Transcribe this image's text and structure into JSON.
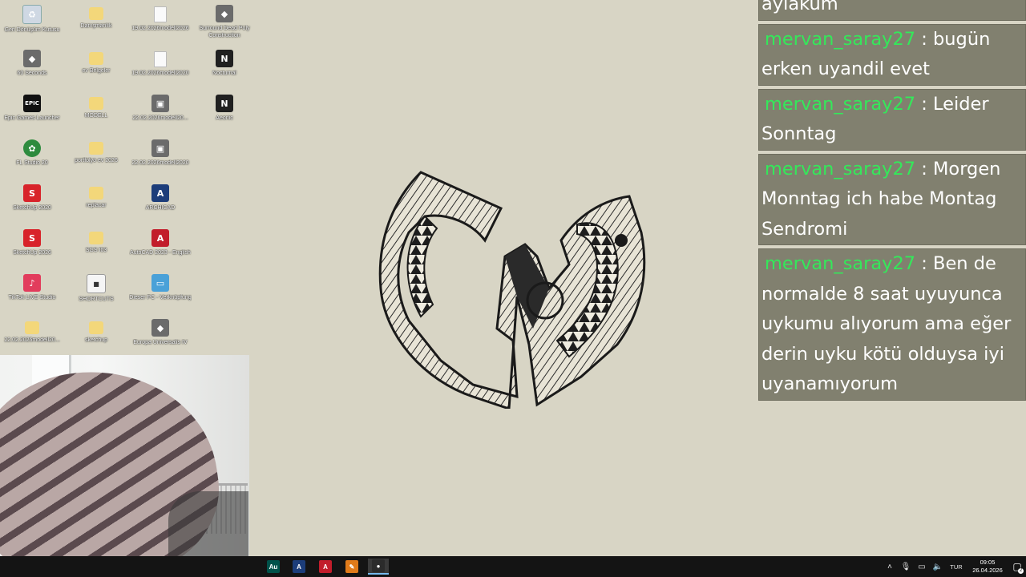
{
  "desktop": {
    "icons": [
      {
        "label": "Geri Dönüşüm Kutusu",
        "icon": "recycle-bin-icon"
      },
      {
        "label": "Danışmanlık",
        "icon": "folder-icon"
      },
      {
        "label": "19.02.2026modell2026",
        "icon": "file-icon"
      },
      {
        "label": "Surround Dead Poly Construction",
        "icon": "game-icon"
      },
      {
        "label": "60 Seconds",
        "icon": "game-icon"
      },
      {
        "label": "ev Belgeler",
        "icon": "folder-icon"
      },
      {
        "label": "19.02.2026modell2020",
        "icon": "file-icon"
      },
      {
        "label": "Nocturnal",
        "icon": "app-icon"
      },
      {
        "label": "Epic Games Launcher",
        "icon": "epic-icon"
      },
      {
        "label": "MODELL",
        "icon": "folder-icon"
      },
      {
        "label": "22.02.2026modell20...",
        "icon": "image-icon"
      },
      {
        "label": "Aeonic",
        "icon": "app-icon"
      },
      {
        "label": "FL Studio 20",
        "icon": "fl-studio-icon"
      },
      {
        "label": "portfolyo ev 2026",
        "icon": "folder-icon"
      },
      {
        "label": "22.02.2026modell2020",
        "icon": "image-icon"
      },
      {
        "label": "SketchUp 2020",
        "icon": "sketchup-icon"
      },
      {
        "label": "replacar",
        "icon": "folder-icon"
      },
      {
        "label": "ARCHICAD",
        "icon": "archicad-icon"
      },
      {
        "label": "SketchUp 2026",
        "icon": "sketchup-icon"
      },
      {
        "label": "SGS İ03",
        "icon": "folder-icon"
      },
      {
        "label": "AutoCAD 2023 - English",
        "icon": "autocad-icon"
      },
      {
        "label": "TikTok LIVE Studio",
        "icon": "tiktok-icon"
      },
      {
        "label": "SHORTCUTS",
        "icon": "shortcuts-icon"
      },
      {
        "label": "Dieser PC - Verknüpfung",
        "icon": "this-pc-icon"
      },
      {
        "label": "22.02.2026modell20...",
        "icon": "folder-icon"
      },
      {
        "label": "sketchup",
        "icon": "folder-icon"
      },
      {
        "label": "Europa Universalis IV",
        "icon": "game-icon"
      }
    ]
  },
  "chat": {
    "messages": [
      {
        "user": "",
        "sep": "",
        "text": "aylakum"
      },
      {
        "user": "mervan_saray27",
        "sep": " : ",
        "text": "bugün erken uyandil evet"
      },
      {
        "user": "mervan_saray27",
        "sep": " : ",
        "text": "Leider Sonntag"
      },
      {
        "user": "mervan_saray27",
        "sep": " : ",
        "text": "Morgen Monntag ich habe Montag Sendromi"
      },
      {
        "user": "mervan_saray27",
        "sep": " : ",
        "text": "Ben de normalde 8 saat uyuyunca uykumu alıyorum ama eğer derin uyku kötü olduysa iyi uyanamıyorum"
      }
    ],
    "colors": {
      "bubble": "#81806f",
      "username": "#34e85a",
      "text": "#ffffff"
    }
  },
  "taskbar": {
    "apps": [
      {
        "name": "audition",
        "label": "Au",
        "color": "#00524a"
      },
      {
        "name": "archicad",
        "label": "A",
        "color": "#1c3d7a"
      },
      {
        "name": "autocad",
        "label": "A",
        "color": "#c21d2b"
      },
      {
        "name": "sketchup",
        "label": "✎",
        "color": "#e07b1a"
      },
      {
        "name": "obs",
        "label": "●",
        "color": "#2b2b2b"
      }
    ],
    "tray": {
      "language": "TUR",
      "time": "09:05",
      "date": "26.04.2026",
      "notifications": "2"
    }
  }
}
